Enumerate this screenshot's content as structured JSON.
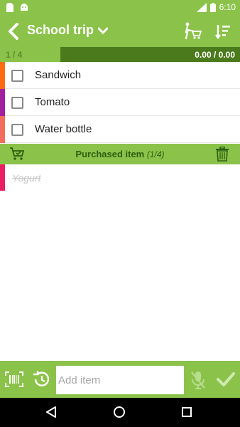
{
  "status_bar": {
    "time": "6:10",
    "network": "LTE"
  },
  "app_bar": {
    "title": "School trip",
    "icons": [
      "back-arrow-icon",
      "chevron-down-icon",
      "cart-person-icon",
      "sort-icon"
    ]
  },
  "progress": {
    "count": "1 / 4",
    "amount": "0.00 / 0.00",
    "fraction": 0.25
  },
  "items": [
    {
      "label": "Sandwich",
      "color": "#ff6a13"
    },
    {
      "label": "Tomato",
      "color": "#a020a0"
    },
    {
      "label": "Water bottle",
      "color": "#f26d5b"
    }
  ],
  "purchased_section": {
    "title": "Purchased item",
    "count": "(1/4)"
  },
  "purchased_items": [
    {
      "label": "Yogurt",
      "color": "#e91e63"
    }
  ],
  "input_bar": {
    "placeholder": "Add item"
  },
  "colors": {
    "accent": "#8bc34a",
    "progress_dark": "#4a7a1c"
  }
}
